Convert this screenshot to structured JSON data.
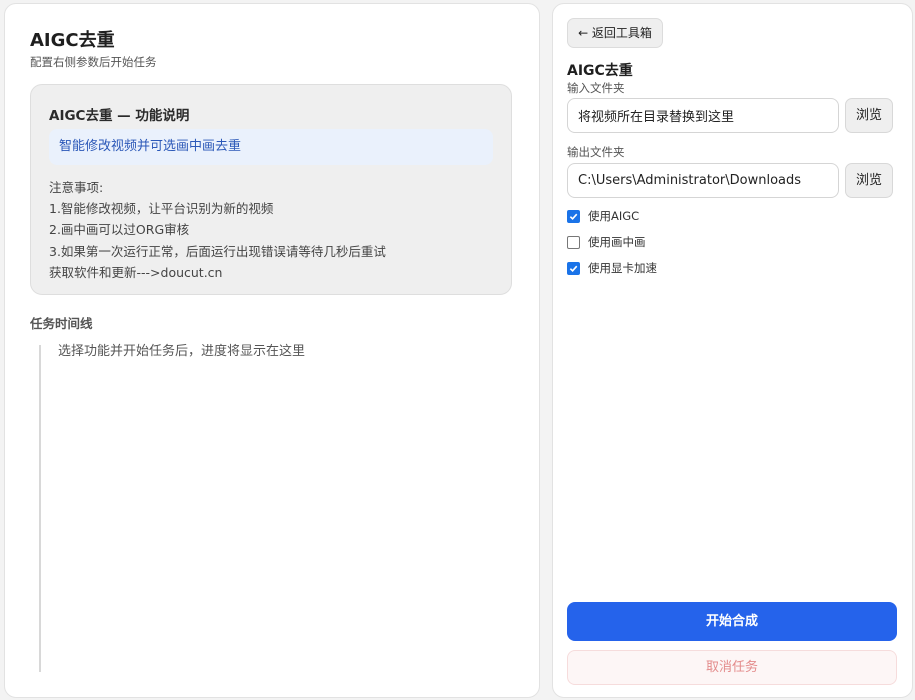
{
  "left": {
    "title": "AIGC去重",
    "subtitle": "配置右侧参数后开始任务",
    "info_card": {
      "title": "AIGC去重 — 功能说明",
      "highlight": "智能修改视频并可选画中画去重",
      "notes": [
        "注意事项:",
        "1.智能修改视频，让平台识别为新的视频",
        "2.画中画可以过ORG审核",
        "3.如果第一次运行正常，后面运行出现错误请等待几秒后重试",
        "获取软件和更新--->doucut.cn"
      ]
    },
    "timeline": {
      "title": "任务时间线",
      "empty_text": "选择功能并开始任务后，进度将显示在这里"
    }
  },
  "right": {
    "back_label": "← 返回工具箱",
    "tool_title": "AIGC去重",
    "input_folder": {
      "label": "输入文件夹",
      "value": "将视频所在目录替换到这里",
      "browse_label": "浏览"
    },
    "output_folder": {
      "label": "输出文件夹",
      "value": "C:\\Users\\Administrator\\Downloads",
      "browse_label": "浏览"
    },
    "options": [
      {
        "label": "使用AIGC",
        "checked": true
      },
      {
        "label": "使用画中画",
        "checked": false
      },
      {
        "label": "使用显卡加速",
        "checked": true
      }
    ],
    "start_label": "开始合成",
    "cancel_label": "取消任务"
  },
  "colors": {
    "accent": "#2563eb",
    "checkbox": "#1a73e8",
    "highlight_bg": "#eaf1fc",
    "highlight_text": "#2b58b8",
    "cancel_text": "#e38b8b"
  }
}
